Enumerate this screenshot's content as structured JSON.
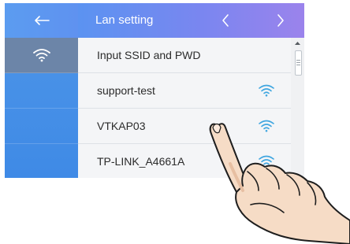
{
  "header": {
    "title": "Lan setting",
    "back_icon": "arrow-left-icon",
    "prev_icon": "chevron-left-icon",
    "next_icon": "chevron-right-icon"
  },
  "sidebar": {
    "items": [
      {
        "icon": "wifi-icon",
        "active": true
      }
    ]
  },
  "networks": [
    {
      "label": "Input SSID and PWD",
      "signal": false
    },
    {
      "label": "support-test",
      "signal": true
    },
    {
      "label": "VTKAP03",
      "signal": true
    },
    {
      "label": "TP-LINK_A4661A",
      "signal": true
    }
  ],
  "colors": {
    "rail": "#4a92e8",
    "rail_active": "#6c85a8",
    "header_start": "#5b93f1",
    "header_end": "#9b83ec",
    "signal": "#3fa6e0"
  },
  "overlay": {
    "icon": "pointing-hand-icon"
  }
}
